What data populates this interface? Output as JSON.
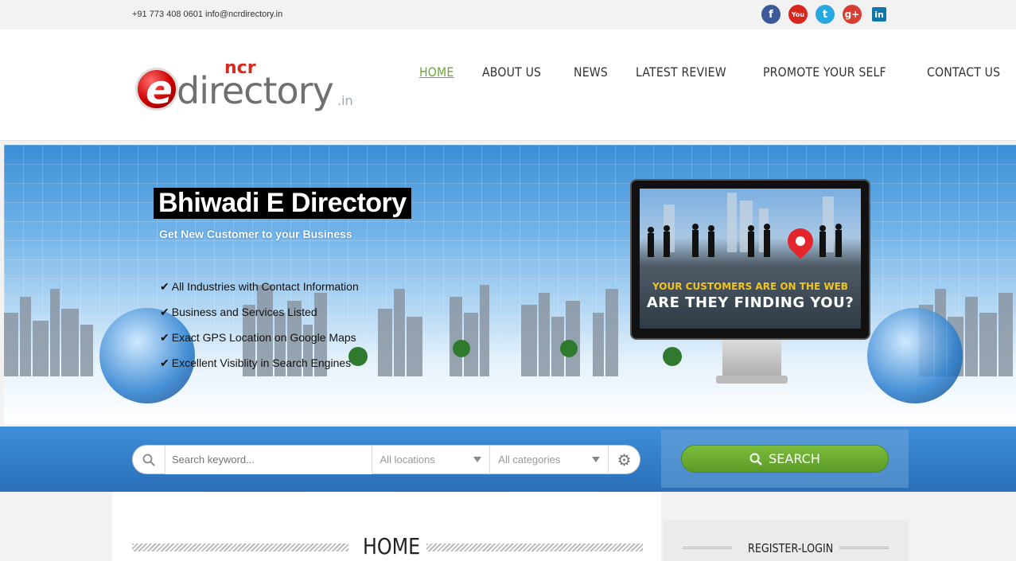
{
  "topbar": {
    "contact": "+91 773 408 0601 info@ncrdirectory.in",
    "socials": [
      {
        "name": "facebook",
        "glyph": "f"
      },
      {
        "name": "youtube",
        "glyph": "You"
      },
      {
        "name": "twitter",
        "glyph": "t"
      },
      {
        "name": "google-plus",
        "glyph": "g+"
      },
      {
        "name": "linkedin",
        "glyph": "in"
      }
    ]
  },
  "logo": {
    "ncr": "ncr",
    "e": "e",
    "word": "directory",
    "tld": ".in"
  },
  "nav": {
    "items": [
      {
        "label": "HOME",
        "active": true
      },
      {
        "label": "ABOUT US",
        "active": false
      },
      {
        "label": "NEWS",
        "active": false
      },
      {
        "label": "LATEST REVIEW",
        "active": false
      },
      {
        "label": "PROMOTE YOUR SELF",
        "active": false
      },
      {
        "label": "CONTACT US",
        "active": false
      }
    ]
  },
  "hero": {
    "title": "Bhiwadi E Directory",
    "subtitle": "Get New Customer to your Business",
    "features": [
      "All Industries with Contact Information",
      "Business and Services Listed",
      "Exact GPS Location on Google Maps",
      "Excellent Visiblity in Search Engines"
    ],
    "check": "✔",
    "monitor_line1": "YOUR CUSTOMERS ARE ON THE WEB",
    "monitor_line2": "ARE THEY FINDING YOU?"
  },
  "search": {
    "keyword_placeholder": "Search keyword...",
    "location_label": "All locations",
    "category_label": "All categories",
    "button_label": "SEARCH"
  },
  "content": {
    "page_title": "HOME"
  },
  "sidebar": {
    "box_title": "REGISTER-LOGIN"
  },
  "colors": {
    "accent_green": "#6aaa2f",
    "search_blue": "#2a6fb8"
  }
}
